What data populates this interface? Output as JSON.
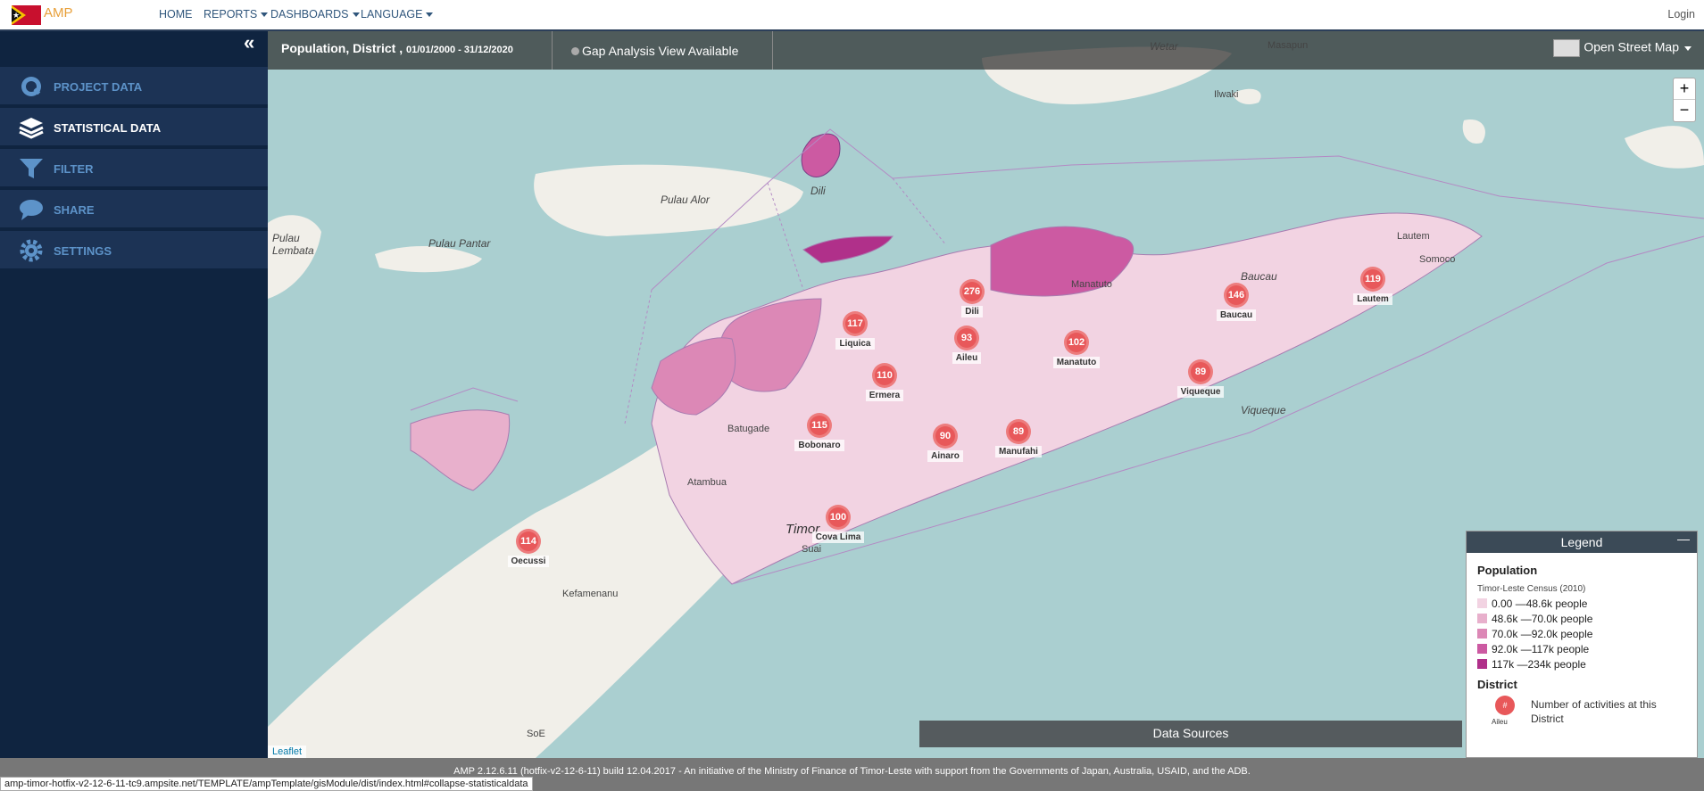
{
  "header": {
    "brand": "AMP",
    "nav": [
      {
        "label": "HOME",
        "has_menu": false
      },
      {
        "label": "REPORTS",
        "has_menu": true
      },
      {
        "label": "DASHBOARDS",
        "has_menu": true
      },
      {
        "label": "LANGUAGE",
        "has_menu": true
      }
    ],
    "login": "Login"
  },
  "sidebar": {
    "items": [
      {
        "label": "PROJECT DATA",
        "icon": "search-icon",
        "active": false
      },
      {
        "label": "STATISTICAL DATA",
        "icon": "layers-icon",
        "active": true
      },
      {
        "label": "FILTER",
        "icon": "filter-icon",
        "active": false
      },
      {
        "label": "SHARE",
        "icon": "speech-bubble-icon",
        "active": false
      },
      {
        "label": "SETTINGS",
        "icon": "gear-icon",
        "active": false
      }
    ]
  },
  "infobar": {
    "title": "Population, District , ",
    "date_range": "01/01/2000 - 31/12/2020",
    "gap_analysis": "Gap Analysis View Available",
    "basemap": "Open Street Map"
  },
  "zoom": {
    "in": "+",
    "out": "−"
  },
  "map_labels": {
    "wetar": "Wetar",
    "masapun": "Masapun",
    "ilwaki": "Ilwaki",
    "pulau_alor": "Pulau Alor",
    "pulau_pantar": "Pulau Pantar",
    "pulau_lembata": "Pulau Lembata",
    "dili_water": "Dili",
    "timor": "Timor",
    "atambua": "Atambua",
    "kefamenanu": "Kefamenanu",
    "soe": "SoE",
    "manatuto_town": "Manatuto",
    "lautem_town": "Lautem",
    "somoco": "Somoco",
    "baucau_town": "Baucau",
    "viqueque_town": "Viqueque",
    "suai": "Suai",
    "batugade": "Batugade"
  },
  "districts": [
    {
      "name": "Dili",
      "count": "276"
    },
    {
      "name": "Liquica",
      "count": "117"
    },
    {
      "name": "Aileu",
      "count": "93"
    },
    {
      "name": "Ermera",
      "count": "110"
    },
    {
      "name": "Bobonaro",
      "count": "115"
    },
    {
      "name": "Ainaro",
      "count": "90"
    },
    {
      "name": "Manufahi",
      "count": "89"
    },
    {
      "name": "Manatuto",
      "count": "102"
    },
    {
      "name": "Baucau",
      "count": "146"
    },
    {
      "name": "Viqueque",
      "count": "89"
    },
    {
      "name": "Lautem",
      "count": "119"
    },
    {
      "name": "Cova Lima",
      "count": "100"
    },
    {
      "name": "Oecussi",
      "count": "114"
    }
  ],
  "attribution": "Leaflet",
  "data_sources": "Data Sources",
  "legend": {
    "title": "Legend",
    "population_heading": "Population",
    "source": "Timor-Leste Census (2010)",
    "ranges": [
      {
        "label": "0.00 —48.6k people",
        "color": "#f2d3e2"
      },
      {
        "label": "48.6k —70.0k people",
        "color": "#e8b0cc"
      },
      {
        "label": "70.0k —92.0k people",
        "color": "#dc88b6"
      },
      {
        "label": "92.0k —117k people",
        "color": "#cc5aa2"
      },
      {
        "label": "117k —234k people",
        "color": "#b0308a"
      }
    ],
    "district_heading": "District",
    "marker_symbol": "#",
    "marker_example": "Aileu",
    "marker_description": "Number of activities at this District"
  },
  "footer": {
    "text": "AMP 2.12.6.11 (hotfix-v2-12-6-11) build 12.04.2017 - An initiative of the Ministry of Finance of Timor-Leste with support from the Governments of Japan, Australia, USAID, and the ADB.",
    "url": "amp-timor-hotfix-v2-12-6-11-tc9.ampsite.net/TEMPLATE/ampTemplate/gisModule/dist/index.html#collapse-statisticaldata"
  }
}
